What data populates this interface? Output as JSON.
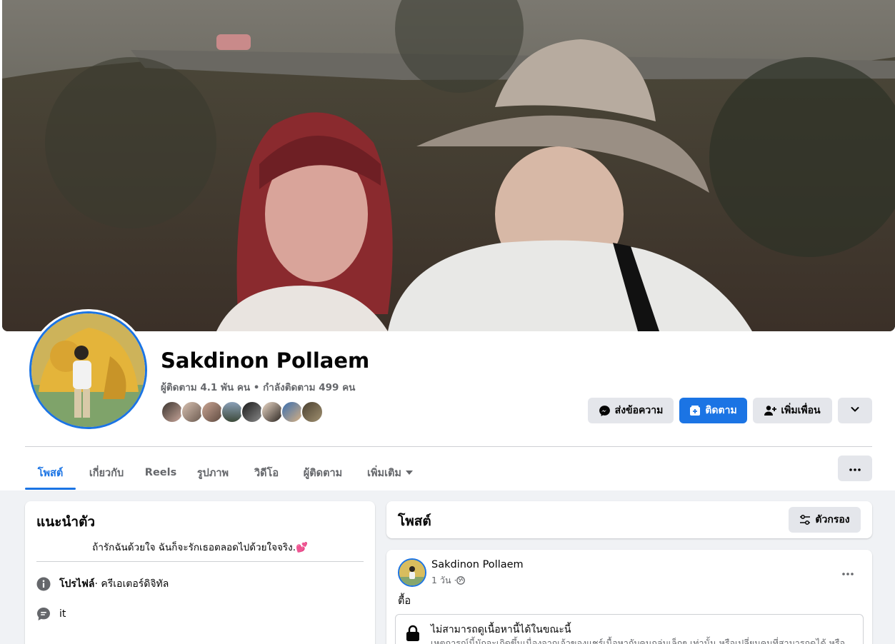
{
  "profile": {
    "name": "Sakdinon Pollaem",
    "stats": "ผู้ติดตาม 4.1 พัน คน • กำลังติดตาม 499 คน"
  },
  "actions": {
    "message": "ส่งข้อความ",
    "follow": "ติดตาม",
    "add_friend": "เพิ่มเพื่อน"
  },
  "tabs": [
    {
      "label": "โพสต์"
    },
    {
      "label": "เกี่ยวกับ"
    },
    {
      "label": "Reels"
    },
    {
      "label": "รูปภาพ"
    },
    {
      "label": "วิดีโอ"
    },
    {
      "label": "ผู้ติดตาม"
    },
    {
      "label": "เพิ่มเติม"
    }
  ],
  "intro": {
    "title": "แนะนำตัว",
    "bio": "ถ้ารักฉันด้วยใจ ฉันก็จะรักเธอตลอดไปด้วยใจจริง.💕",
    "profile_label": "โปรไฟล์",
    "profile_category": " · ครีเอเตอร์ดิจิทัล",
    "extra": "it"
  },
  "posts": {
    "title": "โพสต์",
    "filter": "ตัวกรอง",
    "items": [
      {
        "author": "Sakdinon Pollaem",
        "time": "1 วัน · ",
        "text": "ตื้อ",
        "unavailable_title": "ไม่สามารถดูเนื้อหานี้ได้ในขณะนี้",
        "unavailable_desc": "เหตุการณ์นี้มักจะเกิดขึ้นเนื่องจากเจ้าของแชร์เนื้อหากับคนกลุ่มเล็กๆ เท่านั้น หรือเปลี่ยนคนที่สามารถดูได้ หรือ"
      }
    ]
  },
  "colors": {
    "accent": "#1b74e4",
    "page_bg": "#f0f2f5",
    "secondary_text": "#65676b",
    "button_gray": "#e4e6eb"
  },
  "icons": {
    "message": "messenger-icon",
    "follow": "follow-plus-icon",
    "add_friend": "add-friend-icon",
    "more": "chevron-down-icon",
    "overflow": "more-horizontal-icon",
    "filter": "filter-sliders-icon",
    "info": "info-icon",
    "chat": "chat-bubble-icon",
    "lock": "lock-icon",
    "globe": "globe-icon"
  }
}
